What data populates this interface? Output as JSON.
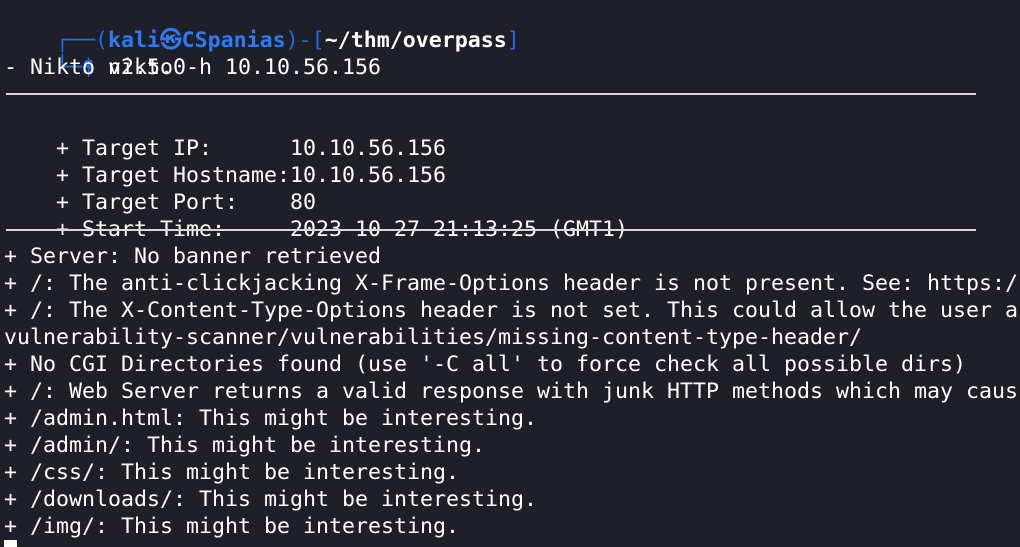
{
  "prompt": {
    "corner_top": "┌──(",
    "user": "kali",
    "at_icon": "㉿",
    "host": "CSpanias",
    "mid": ")-[",
    "path": "~/thm/overpass",
    "close": "]",
    "corner_bottom": "└─",
    "dollar": "$",
    "command": " nikto -h 10.10.56.156"
  },
  "version": "- Nikto v2.5.0",
  "target": [
    {
      "label": "+ Target IP:",
      "value": "10.10.56.156"
    },
    {
      "label": "+ Target Hostname:",
      "value": "10.10.56.156"
    },
    {
      "label": "+ Target Port:",
      "value": "80"
    },
    {
      "label": "+ Start Time:",
      "value": "2023-10-27 21:13:25 (GMT1)"
    }
  ],
  "findings": [
    "+ Server: No banner retrieved",
    "+ /: The anti-clickjacking X-Frame-Options header is not present. See: https:/",
    "+ /: The X-Content-Type-Options header is not set. This could allow the user a",
    "vulnerability-scanner/vulnerabilities/missing-content-type-header/",
    "+ No CGI Directories found (use '-C all' to force check all possible dirs)",
    "+ /: Web Server returns a valid response with junk HTTP methods which may caus",
    "+ /admin.html: This might be interesting.",
    "+ /admin/: This might be interesting.",
    "+ /css/: This might be interesting.",
    "+ /downloads/: This might be interesting.",
    "+ /img/: This might be interesting."
  ],
  "colors": {
    "background": "#1e1f29",
    "prompt_frame": "#1d6cf0",
    "host": "#2f7bf5",
    "text": "#ffffff"
  }
}
